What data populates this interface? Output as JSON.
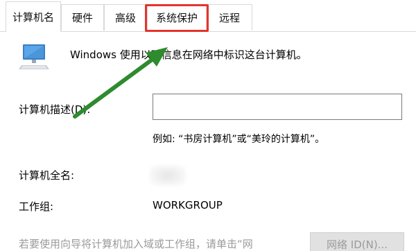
{
  "tabs": [
    {
      "label": "计算机名",
      "active": true
    },
    {
      "label": "硬件"
    },
    {
      "label": "高级"
    },
    {
      "label": "系统保护",
      "highlighted": true
    },
    {
      "label": "远程"
    }
  ],
  "info_text": "Windows 使用以下信息在网络中标识这台计算机。",
  "description": {
    "label": "计算机描述(D):",
    "value": "",
    "example": "例如: “书房计算机”或“美玲的计算机”。"
  },
  "full_name": {
    "label": "计算机全名:",
    "value": ""
  },
  "workgroup": {
    "label": "工作组:",
    "value": "WORKGROUP"
  },
  "hint_text": "若要使用向导将计算机加入域或工作组，请单击“网",
  "network_id_button": "网络 ID(N)...",
  "colors": {
    "highlight": "#e5332b",
    "arrow": "#2e8b2e"
  },
  "icons": [
    "computer-icon"
  ]
}
